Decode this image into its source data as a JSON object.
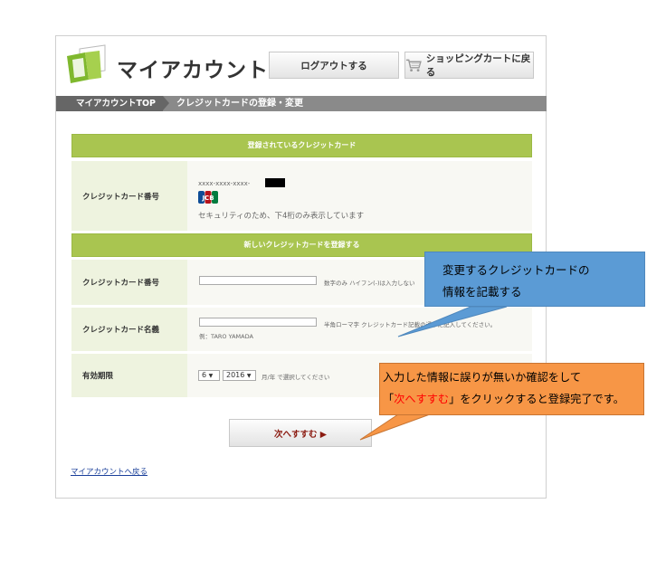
{
  "header": {
    "title": "マイアカウント",
    "logout_label": "ログアウトする",
    "cart_label": "ショッピングカートに戻る"
  },
  "breadcrumb": {
    "home": "マイアカウントTOP",
    "current": "クレジットカードの登録・変更"
  },
  "registered": {
    "heading": "登録されているクレジットカード",
    "card_label": "クレジットカード番号",
    "masked_number": "xxxx-xxxx-xxxx-",
    "brand_icon": "jcb-card-icon",
    "note": "セキュリティのため、下4桁のみ表示しています"
  },
  "new_card": {
    "heading": "新しいクレジットカードを登録する",
    "number_label": "クレジットカード番号",
    "number_value": "",
    "number_hint": "数字のみ ハイフン(-)は入力しない",
    "name_label": "クレジットカード名義",
    "name_value": "",
    "name_hint": "半角ローマ字 クレジットカード記載の通りに記入してください。",
    "name_example": "例：TARO YAMADA",
    "expiry_label": "有効期限",
    "month_value": "6",
    "year_value": "2016",
    "expiry_hint": "月/年 で選択してください"
  },
  "actions": {
    "next_label": "次へすすむ ▶",
    "back_link": "マイアカウントへ戻る"
  },
  "callouts": {
    "blue_line1": "変更するクレジットカードの",
    "blue_line2": "情報を記載する",
    "orange_line1": "入力した情報に誤りが無いか確認をして",
    "orange_pre": "「",
    "orange_highlight": "次へすすむ",
    "orange_post": "」をクリックすると登録完了です。"
  },
  "colors": {
    "green_bar": "#a9c550",
    "callout_blue": "#5b9bd5",
    "callout_orange": "#f79646",
    "highlight_red": "#ff0000",
    "link_blue": "#1a3f9a"
  }
}
